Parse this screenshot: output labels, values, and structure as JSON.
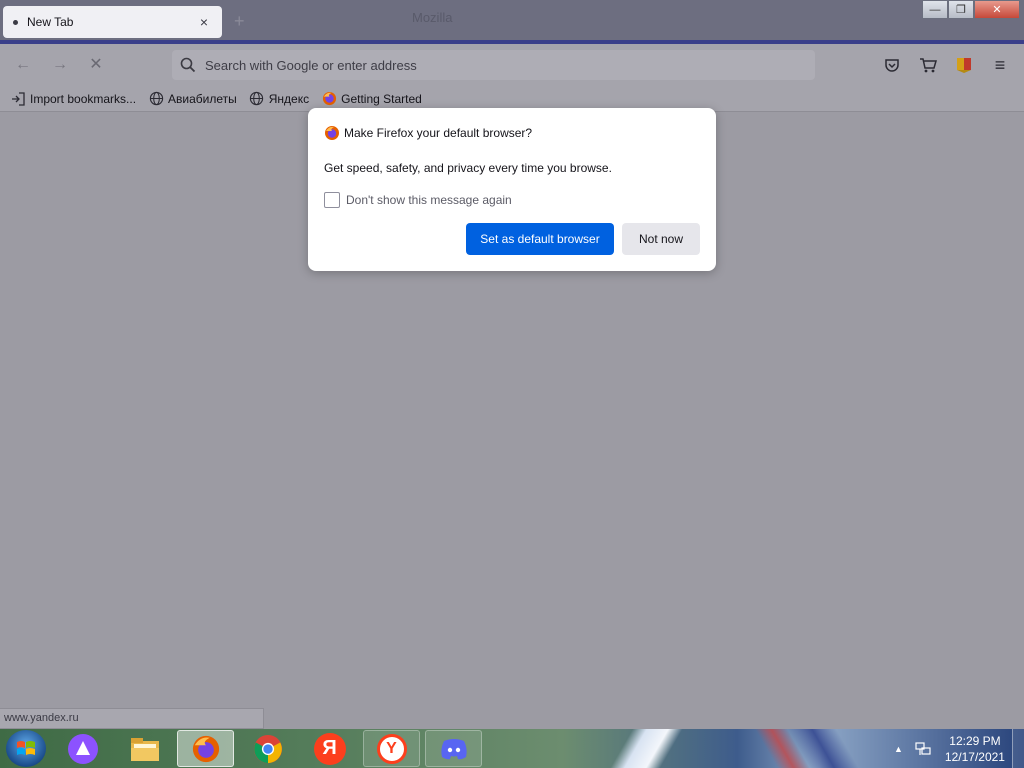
{
  "browser": {
    "tab": {
      "title": "New Tab",
      "close_glyph": "×"
    },
    "new_tab_glyph": "+",
    "window_title_faint": "Mozilla",
    "window_controls": {
      "minimize": "—",
      "maximize": "❐",
      "close": "✕"
    },
    "nav": {
      "back": "←",
      "forward": "→",
      "stop": "✕"
    },
    "urlbar": {
      "placeholder": "Search with Google or enter address",
      "value": ""
    },
    "menu_glyph": "≡",
    "bookmarks": [
      {
        "label": "Import bookmarks...",
        "icon": "import-icon"
      },
      {
        "label": "Авиабилеты",
        "icon": "globe-icon"
      },
      {
        "label": "Яндекс",
        "icon": "globe-icon"
      },
      {
        "label": "Getting Started",
        "icon": "firefox-icon"
      }
    ],
    "status_url": "www.yandex.ru"
  },
  "dialog": {
    "title": "Make Firefox your default browser?",
    "body": "Get speed, safety, and privacy every time you browse.",
    "checkbox_label": "Don't show this message again",
    "checkbox_checked": false,
    "primary_button": "Set as default browser",
    "secondary_button": "Not now"
  },
  "taskbar": {
    "apps": [
      {
        "name": "Alice",
        "icon": "alice-icon"
      },
      {
        "name": "File Explorer",
        "icon": "folder-icon"
      },
      {
        "name": "Firefox",
        "icon": "firefox-icon",
        "active": true
      },
      {
        "name": "Chrome",
        "icon": "chrome-icon"
      },
      {
        "name": "Yandex",
        "icon": "yandex-icon",
        "glyph": "Я"
      },
      {
        "name": "Yandex Browser",
        "icon": "yandex-browser-icon",
        "glyph": "Y"
      },
      {
        "name": "Discord",
        "icon": "discord-icon"
      }
    ],
    "clock": {
      "time": "12:29 PM",
      "date": "12/17/2021"
    },
    "tray_arrow": "▲"
  },
  "colors": {
    "primary_button": "#0061e0",
    "overlay": "#9c9ba3",
    "dialog_bg": "#ffffff"
  }
}
